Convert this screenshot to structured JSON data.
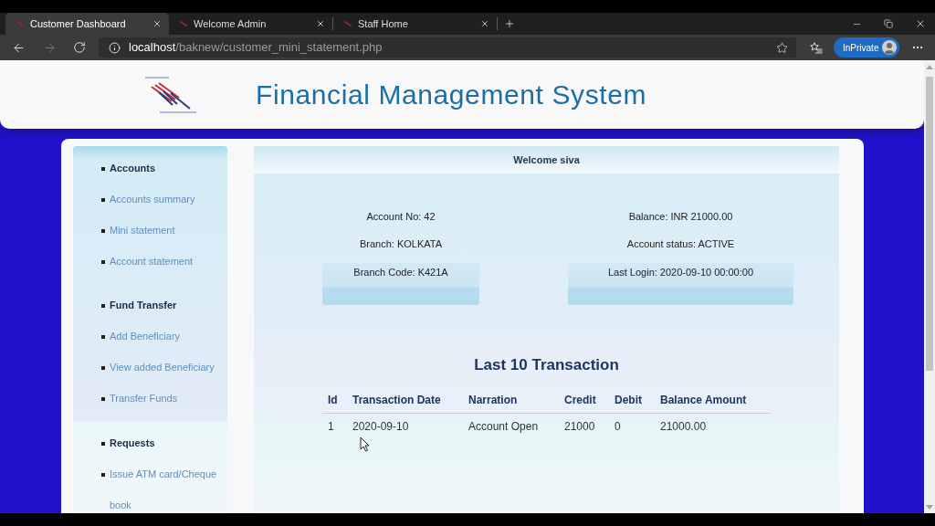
{
  "browser": {
    "tabs": [
      {
        "title": "Customer Dashboard",
        "selected": true
      },
      {
        "title": "Welcome Admin",
        "selected": false
      },
      {
        "title": "Staff Home",
        "selected": false
      }
    ],
    "address": {
      "host": "localhost",
      "path": "/baknew/customer_mini_statement.php"
    },
    "profile": "InPrivate"
  },
  "header": {
    "title": "Financial Management System"
  },
  "sidebar": {
    "sections": [
      {
        "heading": "Accounts",
        "items": [
          "Accounts summary",
          "Mini statement",
          "Account statement"
        ]
      },
      {
        "heading": "Fund Transfer",
        "items": [
          "Add Beneficiary",
          "View added Beneficiary",
          "Transfer Funds"
        ]
      },
      {
        "heading": "Requests",
        "items": [
          "Issue ATM card/Cheque book"
        ]
      }
    ]
  },
  "welcome": "Welcome siva",
  "account": {
    "columns": [
      [
        "Account No: 42",
        "Branch: KOLKATA",
        "Branch Code: K421A"
      ],
      [
        "Balance: INR 21000.00",
        "Account status: ACTIVE",
        "Last Login: 2020-09-10 00:00:00"
      ]
    ]
  },
  "transactions": {
    "title": "Last 10 Transaction",
    "columns": [
      "Id",
      "Transaction Date",
      "Narration",
      "Credit",
      "Debit",
      "Balance Amount"
    ],
    "rows": [
      [
        "1",
        "2020-09-10",
        "Account Open",
        "21000",
        "0",
        "21000.00"
      ]
    ]
  }
}
